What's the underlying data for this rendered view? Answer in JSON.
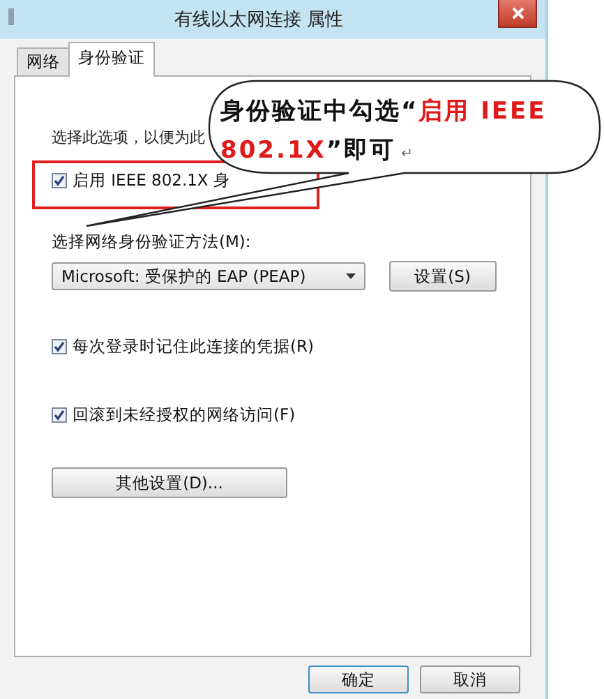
{
  "window": {
    "title": "有线以太网连接 属性"
  },
  "tabs": [
    {
      "label": "网络",
      "selected": false
    },
    {
      "label": "身份验证",
      "selected": true
    }
  ],
  "description": "选择此选项，以便为此",
  "enable_checkbox": {
    "label": "启用 IEEE 802.1X 身",
    "checked": true,
    "highlighted": true
  },
  "method_label": "选择网络身份验证方法(M):",
  "method_dropdown": {
    "value": "Microsoft: 受保护的 EAP (PEAP)"
  },
  "settings_button": "设置(S)",
  "options": [
    {
      "label": "每次登录时记住此连接的凭据(R)",
      "checked": true
    },
    {
      "label": "回滚到未经授权的网络访问(F)",
      "checked": true
    }
  ],
  "other_settings_button": "其他设置(D)...",
  "callout": {
    "parts": [
      {
        "text": "身份验证中勾选“",
        "highlight": false
      },
      {
        "text": "启用 IEEE 802.1X",
        "highlight": true
      },
      {
        "text": "”即可",
        "highlight": false
      }
    ],
    "mark": "↵"
  },
  "buttons": [
    "确定",
    "取消"
  ]
}
